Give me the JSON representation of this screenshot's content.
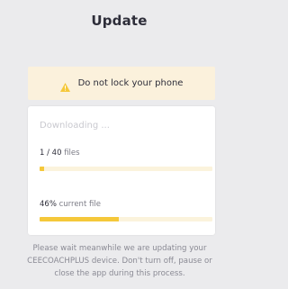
{
  "header": {
    "title": "Update"
  },
  "warning": {
    "icon": "warning-triangle-icon",
    "text": "Do not lock your phone",
    "color": "#f5c83a"
  },
  "progress": {
    "status": "Downloading ...",
    "files": {
      "count": "1 / 40",
      "unit": "files",
      "fraction": 0.025
    },
    "current_file": {
      "percent": "46%",
      "label": "current file",
      "fraction": 0.46
    },
    "bar_fill_color": "#f5c83a",
    "bar_track_color": "#fbf3dc"
  },
  "info": {
    "message": "Please wait meanwhile we are updating your CEECOACHPLUS device. Don't turn off, pause or close the app during this process."
  }
}
